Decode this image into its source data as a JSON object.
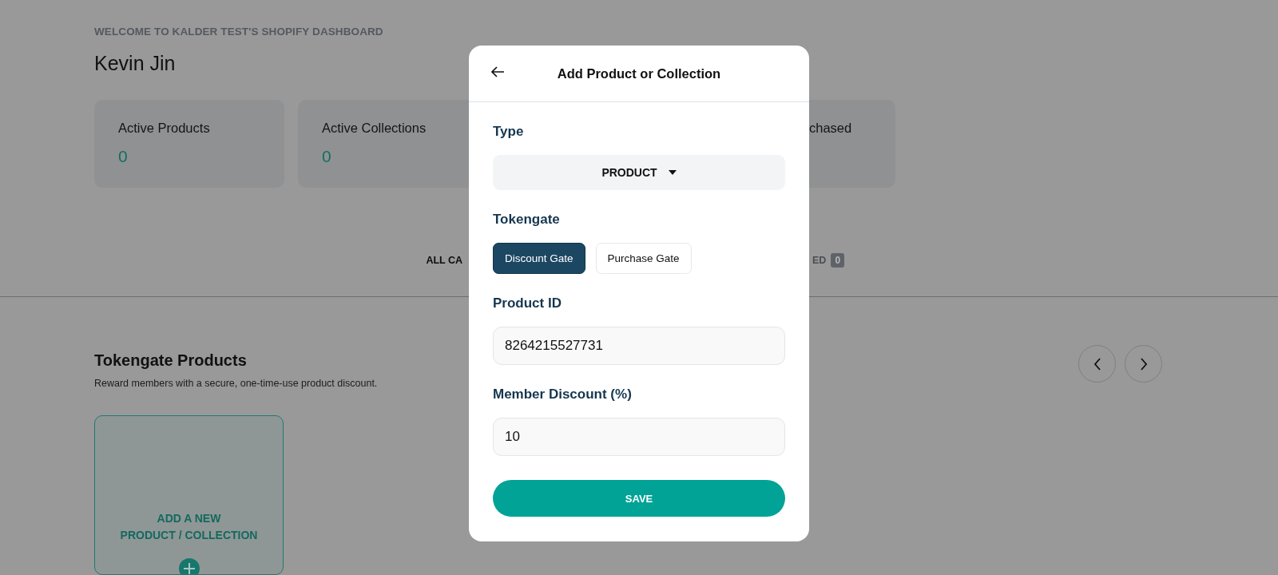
{
  "header": {
    "eyebrow": "WELCOME TO KALDER TEST'S SHOPIFY DASHBOARD",
    "name": "Kevin Jin"
  },
  "stats": [
    {
      "kind": "full",
      "label": "Active Products",
      "value": "0"
    },
    {
      "kind": "full",
      "label": "Active Collections",
      "value": "0"
    },
    {
      "kind": "cut",
      "label": "chased"
    }
  ],
  "tabs": [
    {
      "label": "ALL CA",
      "selected": true
    },
    {
      "label": "ED",
      "selected": false,
      "count": "0"
    }
  ],
  "section": {
    "title": "Tokengate Products",
    "subtitle": "Reward members with a secure, one-time-use product discount.",
    "add_card": {
      "lines": [
        "ADD A NEW",
        "PRODUCT / COLLECTION"
      ]
    }
  },
  "modal": {
    "title": "Add Product or Collection",
    "fields": [
      {
        "kind": "select",
        "label": "Type",
        "value": "PRODUCT"
      },
      {
        "kind": "toggle",
        "label": "Tokengate",
        "options": [
          {
            "label": "Discount Gate",
            "selected": true
          },
          {
            "label": "Purchase Gate",
            "selected": false
          }
        ]
      },
      {
        "kind": "input",
        "label": "Product ID",
        "value": "8264215527731"
      },
      {
        "kind": "input",
        "label": "Member Discount (%)",
        "value": "10"
      }
    ],
    "save": "SAVE"
  }
}
